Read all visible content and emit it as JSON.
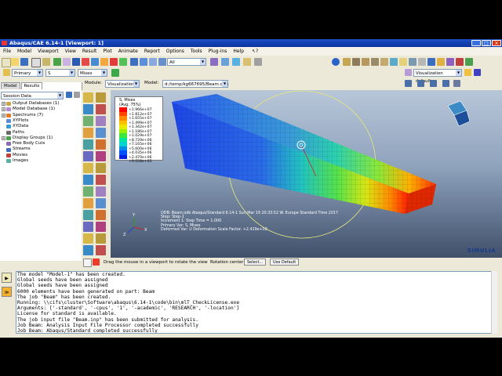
{
  "window": {
    "title": "Abaqus/CAE 6.14-1 [Viewport: 1]"
  },
  "menu": [
    "File",
    "Model",
    "Viewport",
    "View",
    "Result",
    "Plot",
    "Animate",
    "Report",
    "Options",
    "Tools",
    "Plug-ins",
    "Help"
  ],
  "toolbar": {
    "primary_value": "Primary",
    "variable_value": "S",
    "invariant_value": "Mises",
    "all_value": "All",
    "viz_defaults_value": "Visualization defaults"
  },
  "context": {
    "module_label": "Module:",
    "module_value": "Visualization",
    "model_label": "Model:",
    "model_value": "d:/temp/kg667695/Beam.odb"
  },
  "left_panel": {
    "tabs": [
      "Model",
      "Results"
    ],
    "session_value": "Session Data",
    "tree": [
      {
        "label": "Output Databases (1)",
        "expand": "+"
      },
      {
        "label": "Model Database (1)",
        "expand": "+"
      },
      {
        "label": "Spectrums (7)",
        "expand": "+"
      },
      {
        "label": "XYPlots",
        "expand": ""
      },
      {
        "label": "XYData",
        "expand": ""
      },
      {
        "label": "Paths",
        "expand": ""
      },
      {
        "label": "Display Groups (1)",
        "expand": "+"
      },
      {
        "label": "Free Body Cuts",
        "expand": ""
      },
      {
        "label": "Streams",
        "expand": ""
      },
      {
        "label": "Movies",
        "expand": ""
      },
      {
        "label": "Images",
        "expand": ""
      }
    ]
  },
  "legend": {
    "title_lines": [
      "S, Mises",
      "(Avg: 75%)"
    ],
    "values": [
      "+1.966e+07",
      "+1.812e+07",
      "+1.655e+07",
      "+1.499e+07",
      "+1.342e+07",
      "+1.186e+07",
      "+1.029e+07",
      "+8.729e+06",
      "+7.165e+06",
      "+5.600e+06",
      "+4.035e+06",
      "+2.470e+06",
      "+9.058e+05"
    ],
    "colors": [
      "#ff0000",
      "#ff4500",
      "#ff8c00",
      "#ffc000",
      "#e8e800",
      "#9aee00",
      "#3ce63c",
      "#00e69a",
      "#00d2d2",
      "#008ce6",
      "#0050ff",
      "#0020e0",
      "#0000c0"
    ]
  },
  "viewport_info": [
    "ODB: Beam.odb    Abaqus/Standard 6.14-1    Sun Mar 19 20:33:52 W. Europe Standard Time 2017",
    "Step: Step-1",
    "Increment      1: Step Time =    1.000",
    "Primary Var: S, Mises",
    "Deformed Var: U   Deformation Scale Factor: +2.429e+02"
  ],
  "brand": "SIMULIA",
  "prompt": {
    "text": "Drag the mouse in a viewport to rotate the view",
    "rotation_label": "Rotation center:",
    "select_label": "Select...",
    "default_label": "Use Default"
  },
  "messages": [
    "The model \"Model-1\" has been created.",
    "Global seeds have been assigned",
    "Global seeds have been assigned",
    "6000 elements have been generated on part: Beam",
    "The job \"Beam\" has been created.",
    "Running: \\\\cifs\\cluster\\Software\\abaqus\\6.14-1\\code\\bin\\mlT_CheckLicense.exe",
    "Arguments: ['-standard', '-cpus', '1', '-academic', 'RESEARCH', '-location']",
    "License for standard is available.",
    "The job input file \"Beam.inp\" has been submitted for analysis.",
    "Job Beam: Analysis Input File Processor completed successfully",
    "Job Beam: Abaqus/Standard completed successfully",
    "Job Beam completed successfully"
  ]
}
